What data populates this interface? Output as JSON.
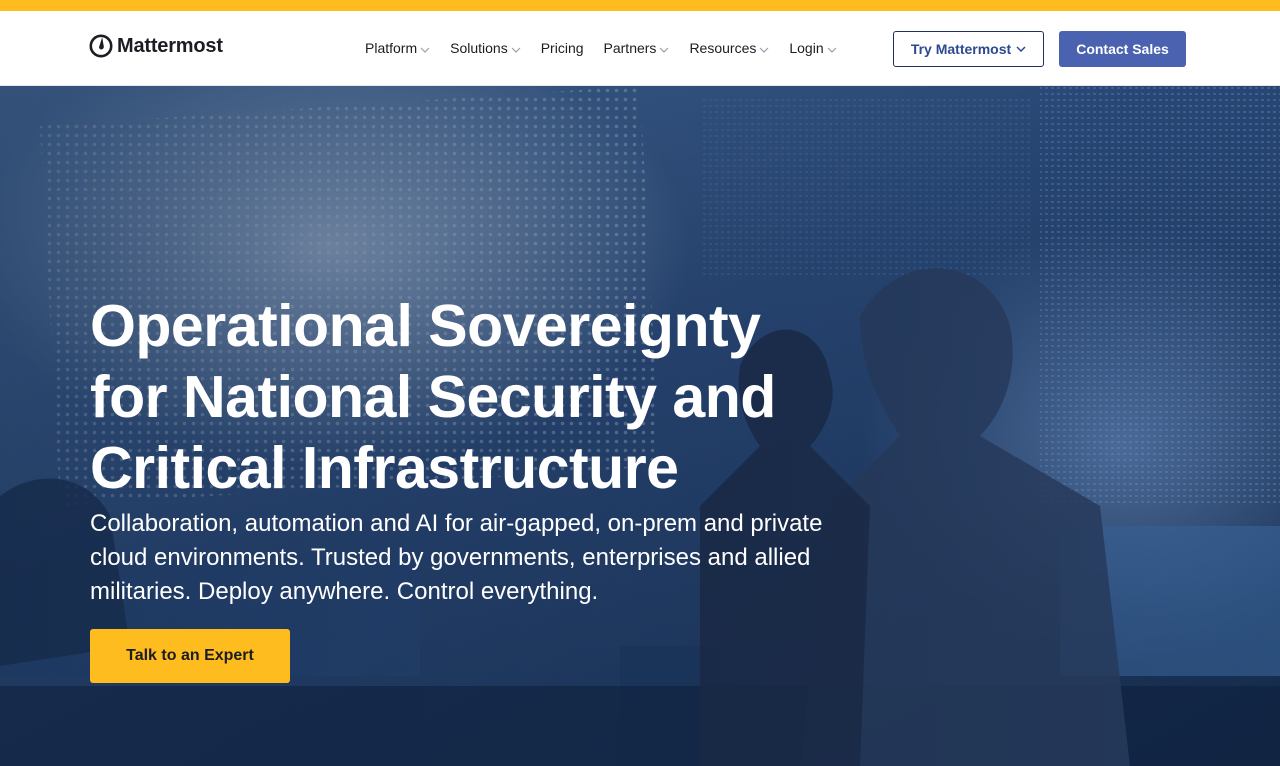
{
  "brand": {
    "name": "Mattermost",
    "logo_icon": "mattermost-logo-icon",
    "accent": "#ffbc1f",
    "primary": "#4a62b0",
    "dark": "#1e325c"
  },
  "nav": {
    "items": [
      {
        "label": "Platform",
        "has_dropdown": true
      },
      {
        "label": "Solutions",
        "has_dropdown": true
      },
      {
        "label": "Pricing",
        "has_dropdown": false
      },
      {
        "label": "Partners",
        "has_dropdown": true
      },
      {
        "label": "Resources",
        "has_dropdown": true
      },
      {
        "label": "Login",
        "has_dropdown": true
      }
    ],
    "try_label": "Try Mattermost",
    "contact_label": "Contact Sales"
  },
  "hero": {
    "title": "Operational Sovereignty for National Security and Critical Infrastructure",
    "subtitle": "Collaboration, automation and AI for air-gapped, on-prem and private cloud environments. Trusted by governments, enterprises and allied militaries. Deploy anywhere. Control everything.",
    "cta_label": "Talk to an Expert"
  }
}
